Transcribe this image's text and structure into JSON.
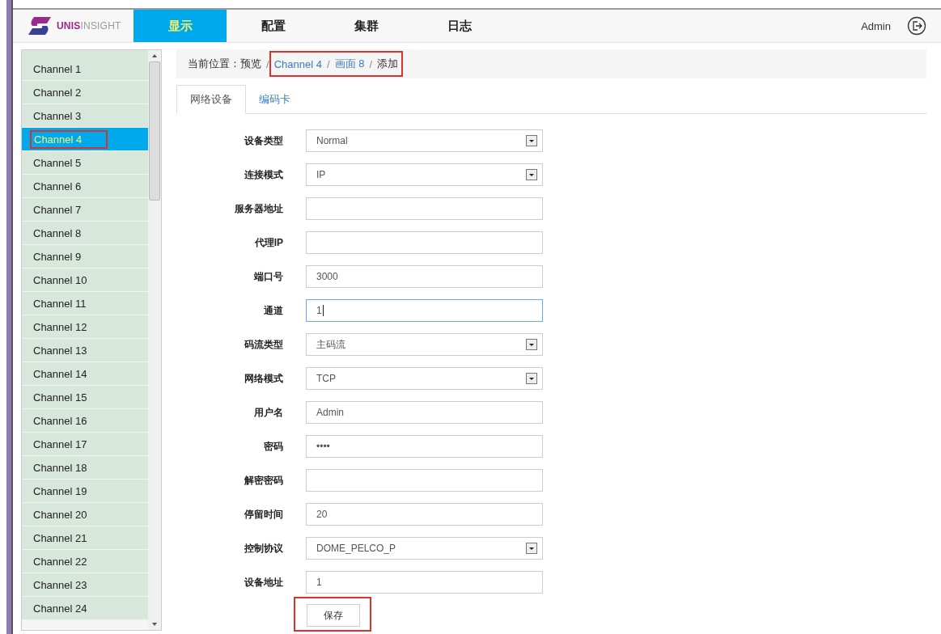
{
  "logo": {
    "brand_bold": "UNIS",
    "brand_rest": "INSIGHT"
  },
  "nav": [
    {
      "label": "显示",
      "selected": true
    },
    {
      "label": "配置",
      "selected": false
    },
    {
      "label": "集群",
      "selected": false
    },
    {
      "label": "日志",
      "selected": false
    }
  ],
  "user": "Admin",
  "sidebar": {
    "items": [
      {
        "label": "Channel 1",
        "selected": false
      },
      {
        "label": "Channel 2",
        "selected": false
      },
      {
        "label": "Channel 3",
        "selected": false
      },
      {
        "label": "Channel 4",
        "selected": true
      },
      {
        "label": "Channel 5",
        "selected": false
      },
      {
        "label": "Channel 6",
        "selected": false
      },
      {
        "label": "Channel 7",
        "selected": false
      },
      {
        "label": "Channel 8",
        "selected": false
      },
      {
        "label": "Channel 9",
        "selected": false
      },
      {
        "label": "Channel 10",
        "selected": false
      },
      {
        "label": "Channel 11",
        "selected": false
      },
      {
        "label": "Channel 12",
        "selected": false
      },
      {
        "label": "Channel 13",
        "selected": false
      },
      {
        "label": "Channel 14",
        "selected": false
      },
      {
        "label": "Channel 15",
        "selected": false
      },
      {
        "label": "Channel 16",
        "selected": false
      },
      {
        "label": "Channel 17",
        "selected": false
      },
      {
        "label": "Channel 18",
        "selected": false
      },
      {
        "label": "Channel 19",
        "selected": false
      },
      {
        "label": "Channel 20",
        "selected": false
      },
      {
        "label": "Channel 21",
        "selected": false
      },
      {
        "label": "Channel 22",
        "selected": false
      },
      {
        "label": "Channel 23",
        "selected": false
      },
      {
        "label": "Channel 24",
        "selected": false
      }
    ]
  },
  "breadcrumb": {
    "prefix": "当前位置：预览",
    "separator": "/",
    "items": [
      {
        "label": "Channel 4",
        "kind": "link"
      },
      {
        "label": "画面 8",
        "kind": "link"
      },
      {
        "label": "添加",
        "kind": "current"
      }
    ]
  },
  "tabs": [
    {
      "label": "网络设备",
      "selected": true
    },
    {
      "label": "编码卡",
      "selected": false
    }
  ],
  "form": [
    {
      "label": "设备类型",
      "kind": "select",
      "value": "Normal"
    },
    {
      "label": "连接模式",
      "kind": "select",
      "value": "IP"
    },
    {
      "label": "服务器地址",
      "kind": "input",
      "focused": false
    },
    {
      "label": "代理IP",
      "kind": "input",
      "focused": false
    },
    {
      "label": "端口号",
      "kind": "input",
      "value": "3000",
      "focused": false
    },
    {
      "label": "通道",
      "kind": "input",
      "value": "1",
      "focused": true
    },
    {
      "label": "码流类型",
      "kind": "select",
      "value": "主码流"
    },
    {
      "label": "网络模式",
      "kind": "select",
      "value": "TCP"
    },
    {
      "label": "用户名",
      "kind": "input",
      "value": "Admin",
      "focused": false
    },
    {
      "label": "密码",
      "kind": "input",
      "value": "••••",
      "focused": false
    },
    {
      "label": "解密密码",
      "kind": "input",
      "focused": false
    },
    {
      "label": "停留时间",
      "kind": "input",
      "value": "20",
      "focused": false
    },
    {
      "label": "控制协议",
      "kind": "select",
      "value": "DOME_PELCO_P"
    },
    {
      "label": "设备地址",
      "kind": "input",
      "value": "1",
      "focused": false
    }
  ],
  "save_button": "保存"
}
